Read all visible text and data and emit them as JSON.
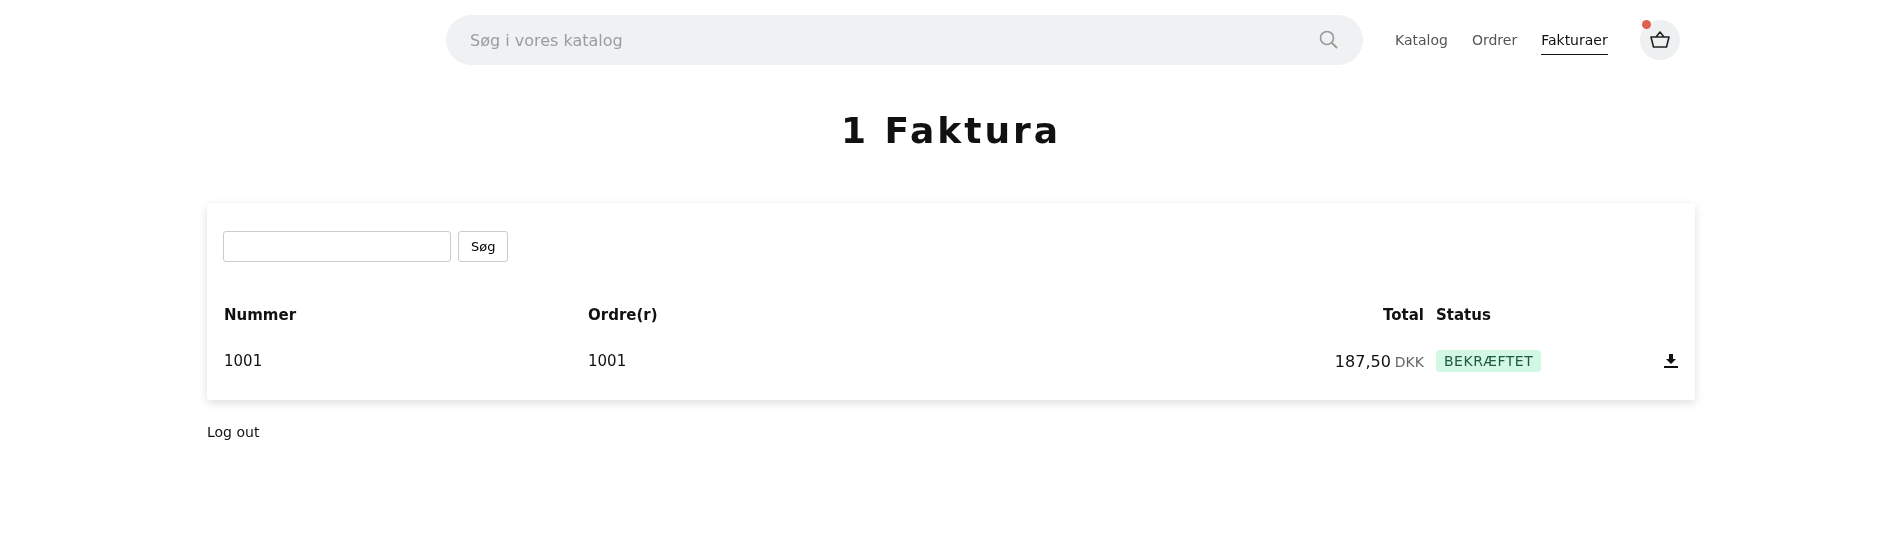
{
  "search": {
    "placeholder": "Søg i vores katalog"
  },
  "nav": [
    {
      "label": "Katalog",
      "selected": false
    },
    {
      "label": "Ordrer",
      "selected": false
    },
    {
      "label": "Fakturaer",
      "selected": true
    }
  ],
  "cart": {
    "has_items": true
  },
  "title": "1 Faktura",
  "filter": {
    "button": "Søg"
  },
  "table": {
    "columns": [
      "Nummer",
      "Ordre(r)",
      "Total",
      "Status"
    ],
    "rows": [
      {
        "number": "1001",
        "orders": "1001",
        "amount": "187,50",
        "currency": "DKK",
        "status": "BEKRÆFTET"
      }
    ]
  },
  "logout": "Log out"
}
